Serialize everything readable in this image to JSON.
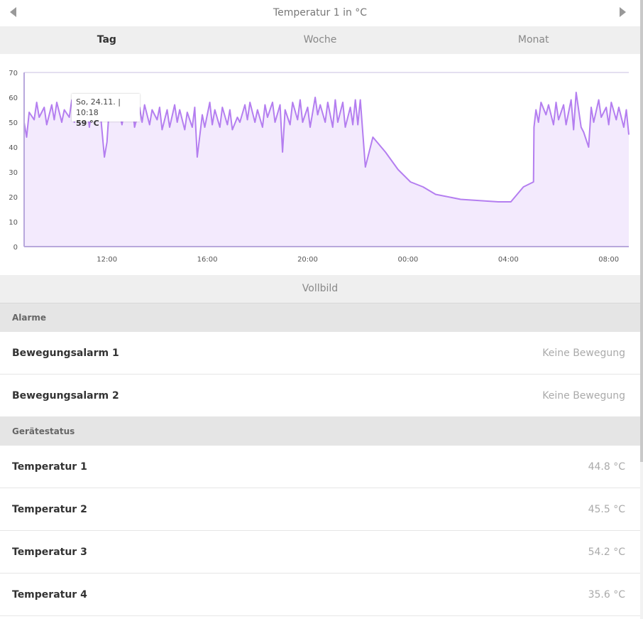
{
  "header": {
    "title": "Temperatur 1 in °C"
  },
  "tabs": [
    {
      "label": "Tag",
      "active": true
    },
    {
      "label": "Woche",
      "active": false
    },
    {
      "label": "Monat",
      "active": false
    }
  ],
  "chart_data": {
    "type": "area",
    "ylim": [
      0,
      70
    ],
    "yticks": [
      0,
      10,
      20,
      30,
      40,
      50,
      60,
      70
    ],
    "xlim": [
      8.7,
      32.8
    ],
    "xticks": [
      {
        "v": 12,
        "label": "12:00"
      },
      {
        "v": 16,
        "label": "16:00"
      },
      {
        "v": 20,
        "label": "20:00"
      },
      {
        "v": 24,
        "label": "00:00"
      },
      {
        "v": 28,
        "label": "04:00"
      },
      {
        "v": 32,
        "label": "08:00"
      }
    ],
    "line_color": "#b47ef0",
    "fill_color": "#f3eafd",
    "x": [
      8.7,
      8.8,
      8.9,
      9.1,
      9.2,
      9.3,
      9.5,
      9.6,
      9.8,
      9.9,
      10.0,
      10.2,
      10.3,
      10.5,
      10.6,
      10.7,
      10.9,
      11.0,
      11.2,
      11.3,
      11.4,
      11.6,
      11.7,
      11.9,
      12.0,
      12.1,
      12.3,
      12.4,
      12.6,
      12.7,
      12.8,
      13.0,
      13.1,
      13.3,
      13.4,
      13.5,
      13.7,
      13.8,
      14.0,
      14.1,
      14.2,
      14.4,
      14.5,
      14.7,
      14.8,
      14.9,
      15.1,
      15.2,
      15.4,
      15.5,
      15.6,
      15.8,
      15.9,
      16.1,
      16.2,
      16.3,
      16.5,
      16.6,
      16.8,
      16.9,
      17.0,
      17.2,
      17.3,
      17.5,
      17.6,
      17.7,
      17.9,
      18.0,
      18.2,
      18.3,
      18.4,
      18.6,
      18.7,
      18.9,
      19.0,
      19.1,
      19.3,
      19.4,
      19.6,
      19.7,
      19.8,
      20.0,
      20.1,
      20.3,
      20.4,
      20.5,
      20.7,
      20.8,
      21.0,
      21.1,
      21.2,
      21.4,
      21.5,
      21.7,
      21.8,
      21.9,
      22.0,
      22.1,
      22.3,
      22.6,
      23.1,
      23.6,
      24.1,
      24.6,
      25.1,
      26.1,
      27.6,
      28.1,
      28.6,
      29.0,
      29.02,
      29.1,
      29.2,
      29.3,
      29.5,
      29.6,
      29.8,
      29.9,
      30.0,
      30.2,
      30.3,
      30.5,
      30.6,
      30.7,
      30.9,
      31.0,
      31.2,
      31.3,
      31.4,
      31.6,
      31.7,
      31.9,
      32.0,
      32.1,
      32.3,
      32.4,
      32.6,
      32.7,
      32.8
    ],
    "y": [
      50,
      44,
      54,
      51,
      58,
      52,
      56,
      49,
      57,
      51,
      58,
      50,
      55,
      52,
      59,
      50,
      55,
      51,
      57,
      48,
      56,
      51,
      58,
      36,
      42,
      57,
      51,
      58,
      49,
      55,
      51,
      59,
      48,
      56,
      50,
      57,
      49,
      55,
      51,
      56,
      47,
      55,
      48,
      57,
      50,
      55,
      47,
      54,
      48,
      56,
      36,
      53,
      48,
      58,
      49,
      55,
      48,
      56,
      49,
      55,
      47,
      52,
      50,
      57,
      51,
      58,
      50,
      55,
      48,
      57,
      52,
      58,
      50,
      57,
      38,
      55,
      49,
      58,
      51,
      59,
      50,
      56,
      48,
      60,
      53,
      57,
      50,
      58,
      48,
      59,
      50,
      58,
      48,
      56,
      49,
      59,
      49,
      59,
      32,
      44,
      38,
      31,
      26,
      24,
      21,
      19,
      18,
      18,
      24,
      26,
      48,
      55,
      50,
      58,
      53,
      57,
      49,
      58,
      51,
      57,
      49,
      59,
      47,
      62,
      48,
      46,
      40,
      56,
      50,
      59,
      52,
      56,
      49,
      58,
      51,
      56,
      48,
      55,
      45
    ],
    "tooltip": {
      "line1": "So, 24.11. | 10:18",
      "line2": "59 °C"
    }
  },
  "fullscreen_label": "Vollbild",
  "sections": {
    "alarms": {
      "title": "Alarme",
      "items": [
        {
          "label": "Bewegungsalarm 1",
          "value": "Keine Bewegung"
        },
        {
          "label": "Bewegungsalarm 2",
          "value": "Keine Bewegung"
        }
      ]
    },
    "status": {
      "title": "Gerätestatus",
      "items": [
        {
          "label": "Temperatur 1",
          "value": "44.8 °C"
        },
        {
          "label": "Temperatur 2",
          "value": "45.5 °C"
        },
        {
          "label": "Temperatur 3",
          "value": "54.2 °C"
        },
        {
          "label": "Temperatur 4",
          "value": "35.6 °C"
        }
      ]
    }
  }
}
